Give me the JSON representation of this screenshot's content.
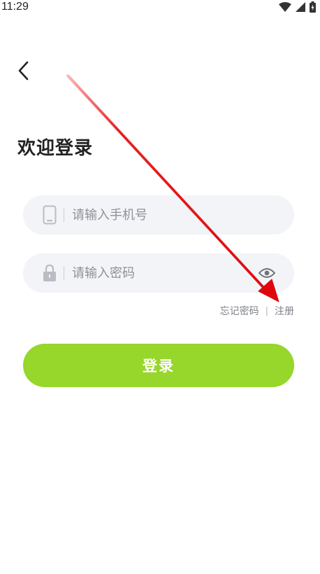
{
  "status_bar": {
    "time": "11:29",
    "icons": [
      "wifi-icon",
      "signal-icon",
      "battery-charging-icon"
    ]
  },
  "header": {
    "back_icon": "chevron-left-icon"
  },
  "page": {
    "title": "欢迎登录"
  },
  "form": {
    "phone": {
      "placeholder": "请输入手机号",
      "value": "",
      "icon": "phone-icon"
    },
    "password": {
      "placeholder": "请输入密码",
      "value": "",
      "icon": "lock-icon",
      "toggle_icon": "eye-icon"
    }
  },
  "links": {
    "forgot_password": "忘记密码",
    "separator": "|",
    "register": "注册"
  },
  "actions": {
    "login_label": "登录"
  },
  "colors": {
    "accent": "#97d62a",
    "field_background": "#f3f4f8",
    "annotation_arrow": "#e8131a"
  }
}
